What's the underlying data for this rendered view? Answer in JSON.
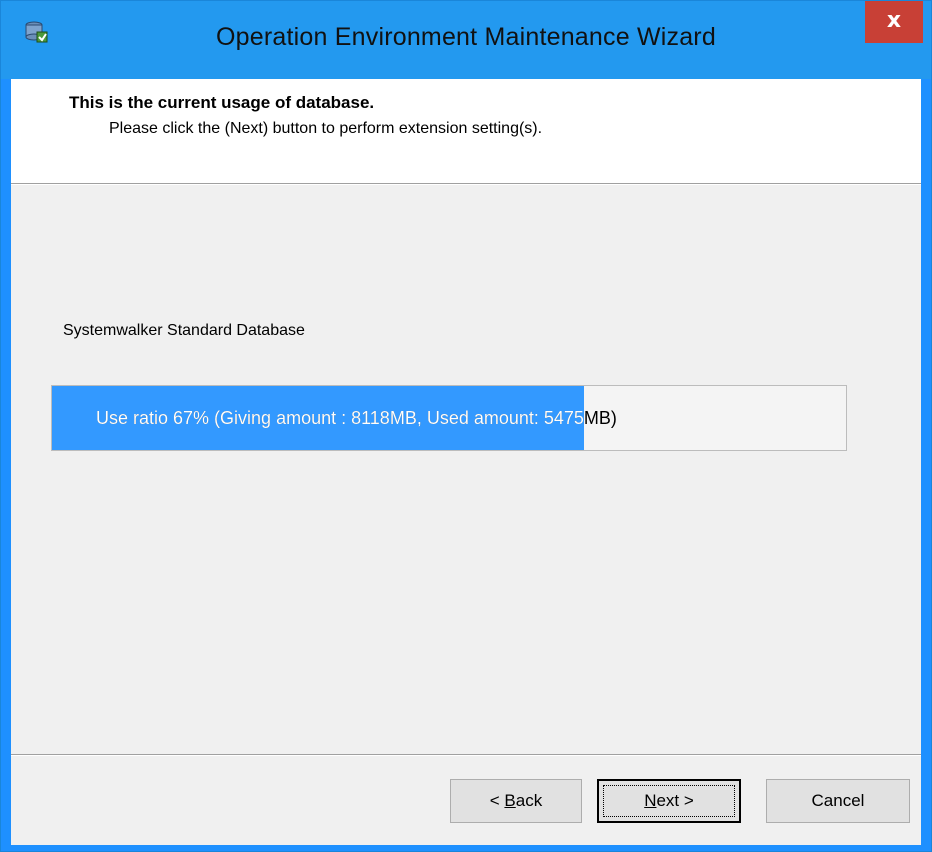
{
  "window": {
    "title": "Operation Environment Maintenance Wizard",
    "close_label": "x",
    "accent_color": "#2399ef",
    "close_color": "#c84036"
  },
  "header": {
    "title": "This is the current usage of database.",
    "subtitle": "Please click the (Next) button to perform extension setting(s)."
  },
  "database": {
    "name": "Systemwalker Standard Database",
    "usage_text": "Use ratio 67% (Giving amount : 8118MB, Used amount: 5475MB)",
    "use_ratio_percent": 67,
    "progress_color": "#3399ff"
  },
  "buttons": {
    "back_prefix": "< ",
    "back_mnemonic": "B",
    "back_rest": "ack",
    "next_mnemonic": "N",
    "next_rest": "ext >",
    "cancel": "Cancel"
  },
  "icons": {
    "app": "database-wizard-icon"
  }
}
